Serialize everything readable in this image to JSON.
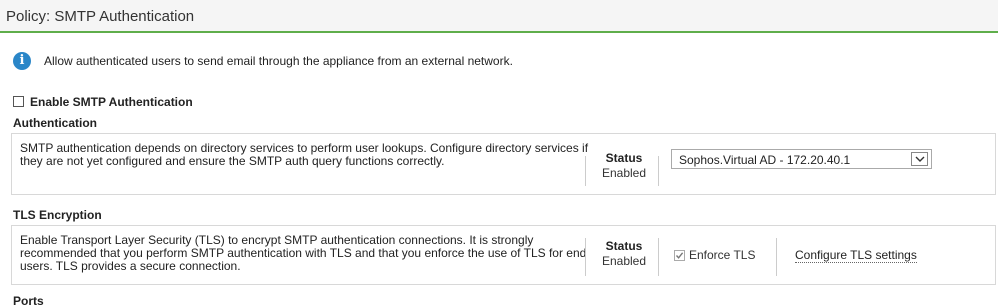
{
  "header": {
    "title": "Policy: SMTP Authentication"
  },
  "info": {
    "icon": "info-icon",
    "text": "Allow authenticated users to send email through the appliance from an external network."
  },
  "enable": {
    "label": "Enable SMTP Authentication",
    "checked": false
  },
  "authentication": {
    "heading": "Authentication",
    "description": "SMTP authentication depends on directory services to perform user lookups. Configure directory services if they are not yet configured and ensure the SMTP auth query functions correctly.",
    "status_label": "Status",
    "status_value": "Enabled",
    "directory_select": {
      "selected": "Sophos.Virtual AD - 172.20.40.1"
    }
  },
  "tls": {
    "heading": "TLS Encryption",
    "description": "Enable Transport Layer Security (TLS) to encrypt SMTP authentication connections. It is strongly recommended that you perform SMTP authentication with TLS and that you enforce the use of TLS for end users. TLS provides a secure connection.",
    "status_label": "Status",
    "status_value": "Enabled",
    "enforce_label": "Enforce TLS",
    "enforce_checked": true,
    "configure_link": "Configure TLS settings"
  },
  "ports": {
    "heading": "Ports"
  },
  "colors": {
    "accent": "#5fae4b",
    "info": "#2a86c8"
  }
}
